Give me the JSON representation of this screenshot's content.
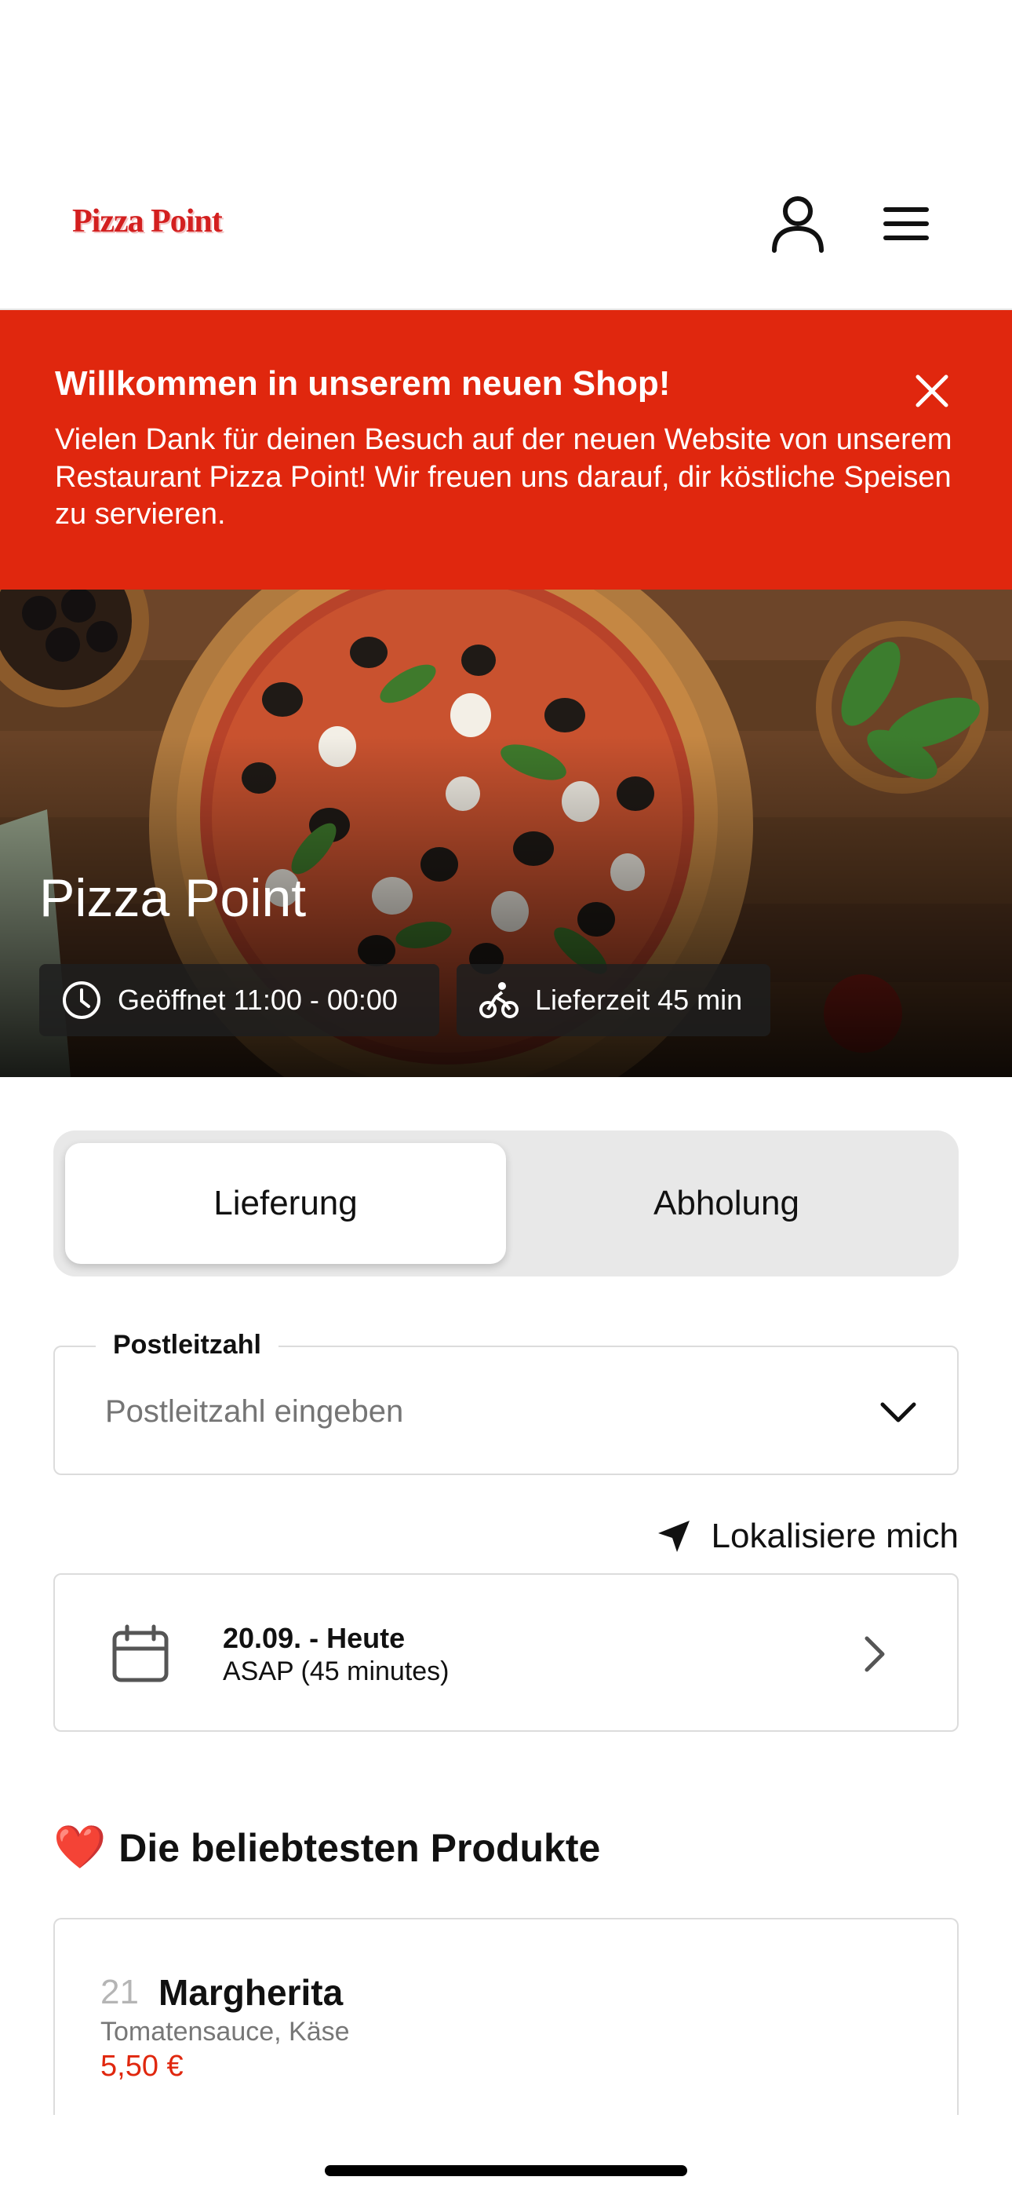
{
  "header": {
    "logo_text": "Pizza Point",
    "user_icon": "user-icon",
    "menu_icon": "hamburger-menu-icon"
  },
  "banner": {
    "title": "Willkommen in unserem neuen Shop!",
    "text": "Vielen Dank für deinen Besuch auf der neuen Website von unserem Restaurant Pizza Point! Wir freuen uns darauf, dir köstliche Speisen zu servieren.",
    "close_icon": "close-icon",
    "bg_color": "#e0270e"
  },
  "hero": {
    "title": "Pizza Point",
    "hours": "Geöffnet 11:00 - 00:00",
    "delivery_time": "Lieferzeit 45 min",
    "hours_icon": "clock-icon",
    "delivery_icon": "bicycle-icon"
  },
  "order_mode": {
    "options": [
      "Lieferung",
      "Abholung"
    ],
    "selected": "Lieferung"
  },
  "postcode": {
    "label": "Postleitzahl",
    "placeholder": "Postleitzahl eingeben",
    "value": ""
  },
  "locate": {
    "label": "Lokalisiere mich",
    "icon": "location-arrow-icon"
  },
  "schedule": {
    "date": "20.09. - Heute",
    "time": "ASAP (45 minutes)",
    "icon": "calendar-icon"
  },
  "popular": {
    "title": "Die beliebtesten Produkte",
    "heart": "❤️",
    "products": [
      {
        "number": "21",
        "name": "Margherita",
        "description": "Tomatensauce, Käse",
        "price": "5,50 €"
      }
    ]
  },
  "colors": {
    "accent": "#e0270e",
    "price": "#e0270e"
  }
}
